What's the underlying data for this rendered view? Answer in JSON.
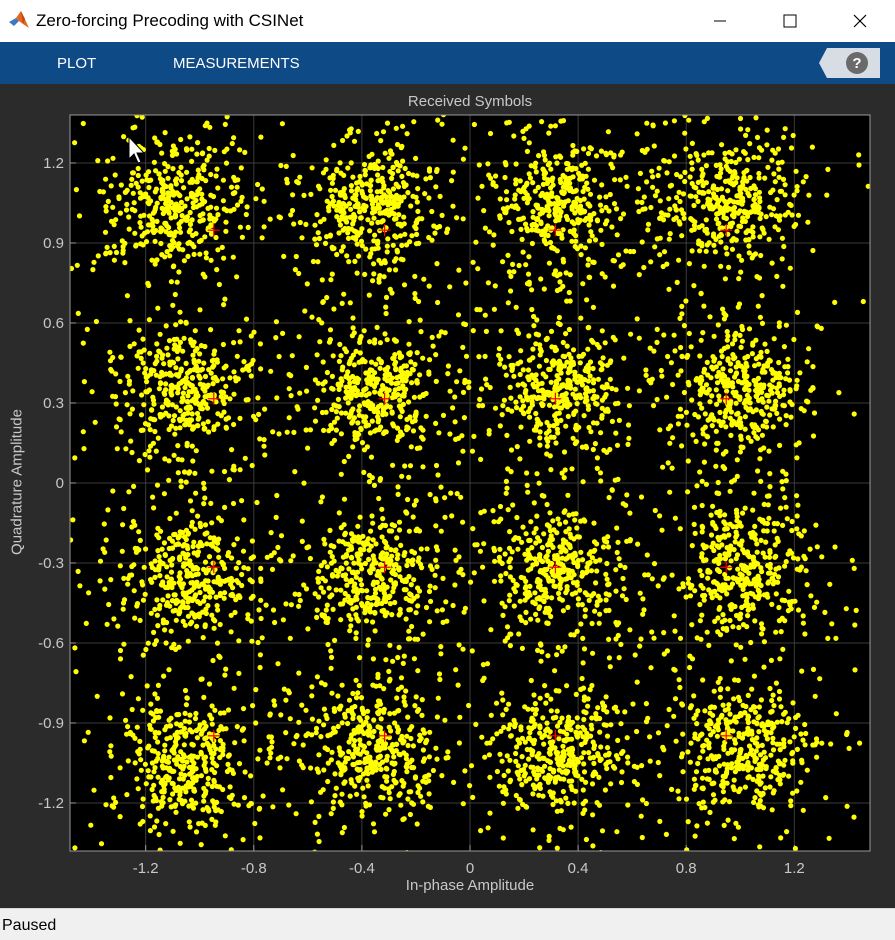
{
  "window": {
    "title": "Zero-forcing Precoding with CSINet",
    "minimize_icon": "minimize-icon",
    "maximize_icon": "maximize-icon",
    "close_icon": "close-icon"
  },
  "toolstrip": {
    "tabs": [
      {
        "label": "PLOT"
      },
      {
        "label": "MEASUREMENTS"
      }
    ],
    "help_icon": "help-icon",
    "background": "#0d4a86"
  },
  "status": {
    "text": "Paused"
  },
  "chart_data": {
    "type": "scatter",
    "title": "Received Symbols",
    "xlabel": "In-phase Amplitude",
    "ylabel": "Quadrature Amplitude",
    "xlim": [
      -1.48,
      1.48
    ],
    "ylim": [
      -1.38,
      1.38
    ],
    "x_ticks": [
      "-1.2",
      "-0.8",
      "-0.4",
      "0",
      "0.4",
      "0.8",
      "1.2"
    ],
    "x_tick_values": [
      -1.2,
      -0.8,
      -0.4,
      0,
      0.4,
      0.8,
      1.2
    ],
    "y_ticks": [
      "1.2",
      "0.9",
      "0.6",
      "0.3",
      "0",
      "-0.3",
      "-0.6",
      "-0.9",
      "-1.2"
    ],
    "y_tick_values": [
      1.2,
      0.9,
      0.6,
      0.3,
      0,
      -0.3,
      -0.6,
      -0.9,
      -1.2
    ],
    "grid": true,
    "background": "#000000",
    "series": [
      {
        "marker": "dot",
        "color": "#ffff00",
        "cluster_centers": [
          [
            -1.1,
            1.05
          ],
          [
            -0.35,
            1.05
          ],
          [
            0.32,
            1.05
          ],
          [
            0.95,
            1.05
          ],
          [
            -1.05,
            0.35
          ],
          [
            -0.35,
            0.35
          ],
          [
            0.32,
            0.35
          ],
          [
            1.0,
            0.35
          ],
          [
            -1.05,
            -0.35
          ],
          [
            -0.35,
            -0.35
          ],
          [
            0.32,
            -0.32
          ],
          [
            1.0,
            -0.32
          ],
          [
            -1.05,
            -1.05
          ],
          [
            -0.35,
            -1.0
          ],
          [
            0.32,
            -1.0
          ],
          [
            1.0,
            -1.0
          ]
        ],
        "cluster_spread": 0.2,
        "points_per_cluster": 420
      },
      {
        "marker": "plus",
        "color": "#ff0000",
        "points": [
          [
            -0.948,
            0.948
          ],
          [
            -0.316,
            0.948
          ],
          [
            0.316,
            0.948
          ],
          [
            0.948,
            0.948
          ],
          [
            -0.948,
            0.316
          ],
          [
            -0.316,
            0.316
          ],
          [
            0.316,
            0.316
          ],
          [
            0.948,
            0.316
          ],
          [
            -0.948,
            -0.316
          ],
          [
            -0.316,
            -0.316
          ],
          [
            0.316,
            -0.316
          ],
          [
            0.948,
            -0.316
          ],
          [
            -0.948,
            -0.948
          ],
          [
            -0.316,
            -0.948
          ],
          [
            0.316,
            -0.948
          ],
          [
            0.948,
            -0.948
          ]
        ]
      }
    ]
  }
}
